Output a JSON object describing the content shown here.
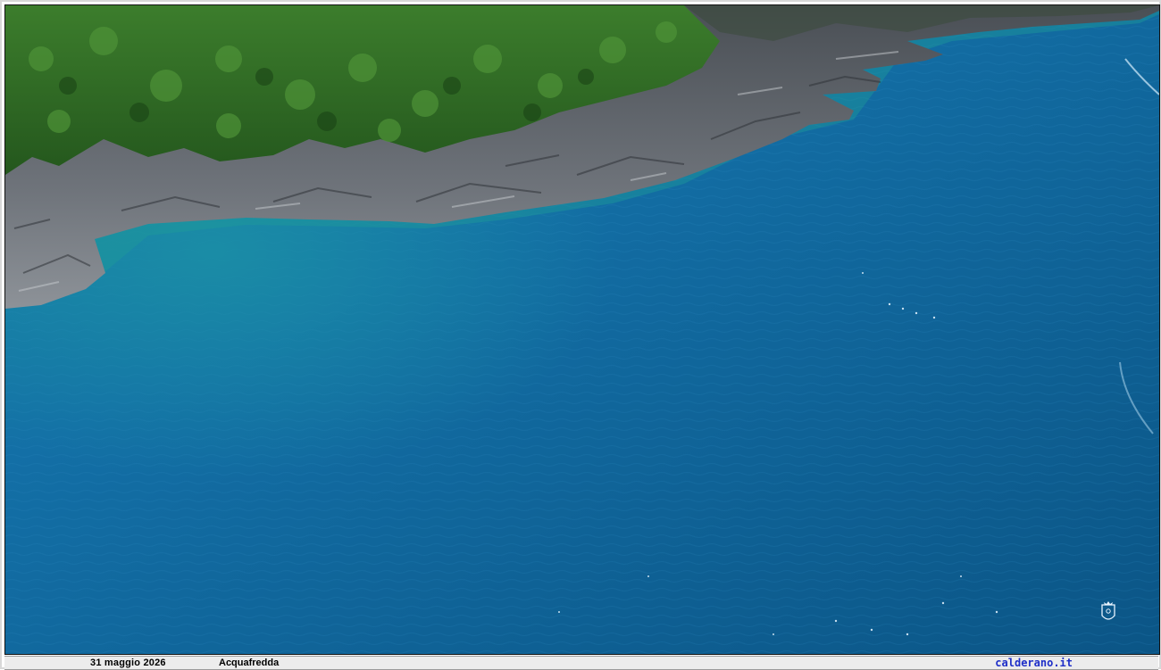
{
  "footer": {
    "date": "31 maggio 2026",
    "place": "Acquafredda",
    "site": "calderano.it"
  },
  "photo": {
    "subject": "aerial-coast-sea",
    "colors": {
      "sea_deep": "#0c5a8a",
      "sea_mid": "#1479ad",
      "sea_shallow": "#1c8fa8",
      "rock": "#5a5f66",
      "vegetation": "#2e6a23"
    }
  },
  "watermark": {
    "icon": "seal-icon"
  }
}
